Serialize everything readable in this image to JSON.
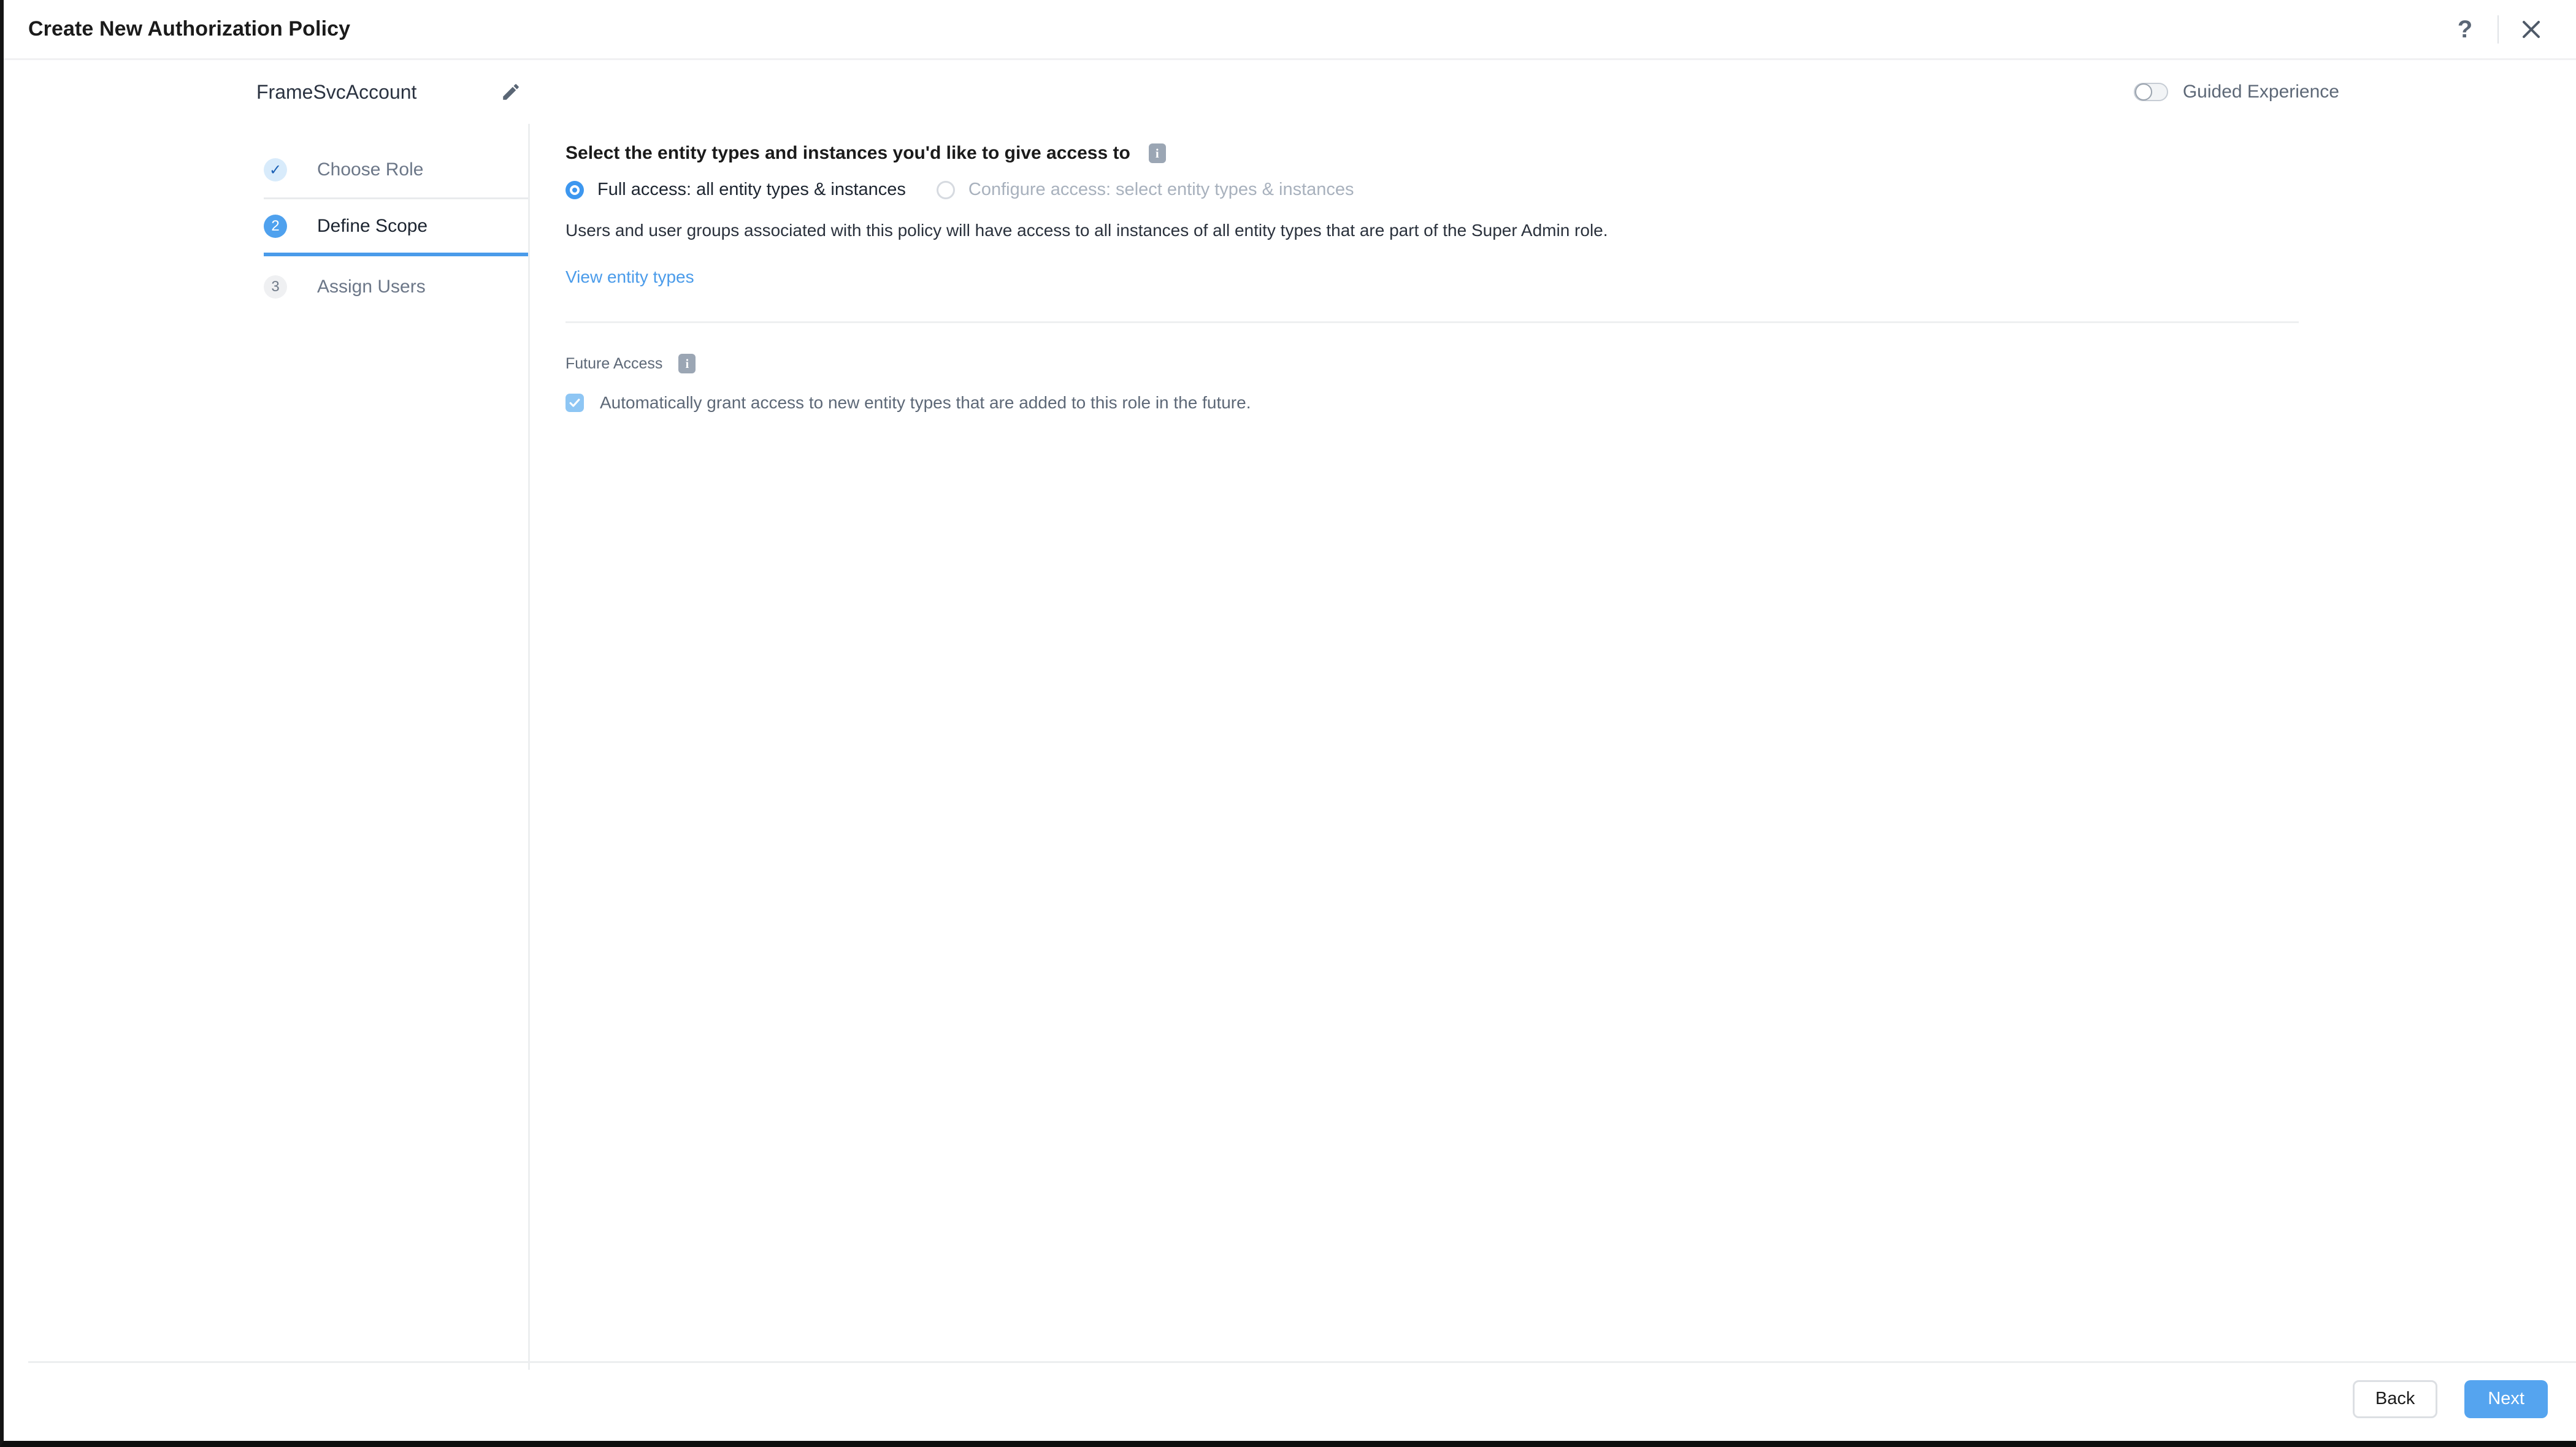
{
  "window": {
    "title": "Create New Authorization Policy",
    "help_icon": "question-mark-icon",
    "close_icon": "close-icon"
  },
  "subheader": {
    "policy_name": "FrameSvcAccount",
    "edit_icon": "pencil-icon",
    "guided_experience_label": "Guided Experience",
    "guided_experience_on": false
  },
  "stepper": {
    "steps": [
      {
        "number": "✓",
        "label": "Choose Role",
        "state": "completed"
      },
      {
        "number": "2",
        "label": "Define Scope",
        "state": "active"
      },
      {
        "number": "3",
        "label": "Assign Users",
        "state": "upcoming"
      }
    ]
  },
  "main": {
    "heading": "Select the entity types and instances you'd like to give access to",
    "heading_info_icon": "info-icon",
    "radio_options": [
      {
        "label": "Full access: all entity types & instances",
        "selected": true,
        "disabled": false
      },
      {
        "label": "Configure access: select entity types & instances",
        "selected": false,
        "disabled": true
      }
    ],
    "description": "Users and user groups associated with this policy will have access to all instances of all entity types that are part of the Super Admin role.",
    "view_entity_types_link": "View entity types",
    "future_access": {
      "label": "Future Access",
      "info_icon": "info-icon",
      "checkbox_label": "Automatically grant access to new entity types that are added to this role in the future.",
      "checked": true
    }
  },
  "footer": {
    "back_label": "Back",
    "next_label": "Next"
  },
  "colors": {
    "accent_blue": "#4a9bea",
    "primary_button": "#55a4ef",
    "step_active": "#4fa1ee",
    "step_done_bg": "#d8ebfb",
    "checkbox_blue": "#8ec6f4",
    "muted_text": "#5d6877"
  }
}
